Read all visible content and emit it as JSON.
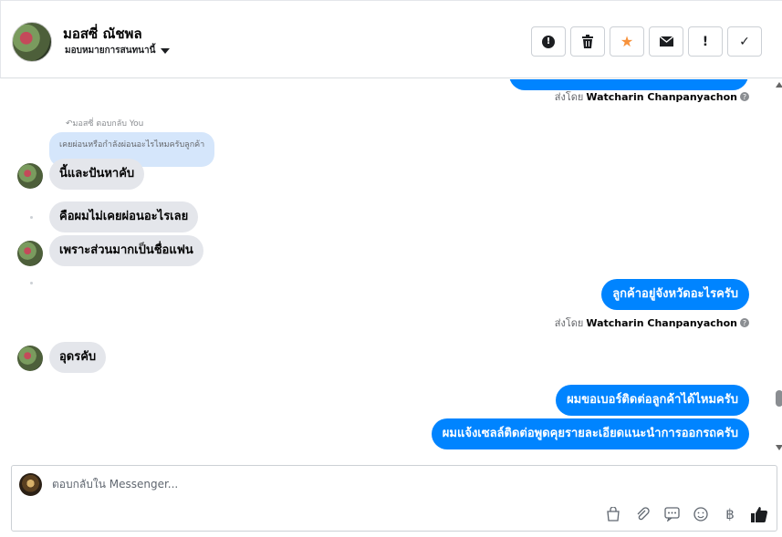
{
  "header": {
    "contact_name": "มอสซี่ ณัชพล",
    "assign_label": "มอบหมายการสนทนานี้",
    "actions": [
      {
        "name": "report-button",
        "icon": "alert-circle-icon",
        "glyph": "●"
      },
      {
        "name": "delete-button",
        "icon": "trash-icon",
        "glyph": "🗑"
      },
      {
        "name": "star-button",
        "icon": "star-icon",
        "glyph": "★"
      },
      {
        "name": "mark-unread-button",
        "icon": "envelope-icon",
        "glyph": "✉"
      },
      {
        "name": "flag-button",
        "icon": "exclamation-icon",
        "glyph": "!"
      },
      {
        "name": "done-button",
        "icon": "check-icon",
        "glyph": "✓"
      }
    ]
  },
  "messages": {
    "sent_by_1": {
      "prefix": "ส่งโดย",
      "name": "Watcharin Chanpanyachon"
    },
    "reply_meta": "มอสซี่ ตอบกลับ You",
    "reply_quote": "เคยผ่อนหรือกำลังผ่อนอะไรไหมครับลูกค้า",
    "in_1": "นี้และปันหาคับ",
    "in_2": "คือผมไม่เคยผ่อนอะไรเลย",
    "in_3": "เพราะส่วนมากเป็นชื่อแฟน",
    "out_1": "ลูกค้าอยู่จังหวัดอะไรครับ",
    "sent_by_2": {
      "prefix": "ส่งโดย",
      "name": "Watcharin Chanpanyachon"
    },
    "in_4": "อุดรคับ",
    "out_2": "ผมขอเบอร์ติดต่อลูกค้าได้ไหมครับ",
    "out_3": "ผมแจ้งเซลล์ติดต่อพูดคุยรายละเอียดแนะนำการออกรถครับ"
  },
  "composer": {
    "placeholder": "ตอบกลับใน Messenger...",
    "tools": [
      {
        "name": "shop-icon",
        "glyph": "🛍"
      },
      {
        "name": "attach-icon",
        "glyph": "📎"
      },
      {
        "name": "saved-reply-icon",
        "glyph": "💬"
      },
      {
        "name": "emoji-icon",
        "glyph": "☺"
      },
      {
        "name": "payment-icon",
        "glyph": "฿"
      },
      {
        "name": "like-icon",
        "glyph": "👍"
      }
    ]
  },
  "colors": {
    "accent": "#0084ff",
    "incoming": "#e4e6eb",
    "star": "#f7923b"
  }
}
